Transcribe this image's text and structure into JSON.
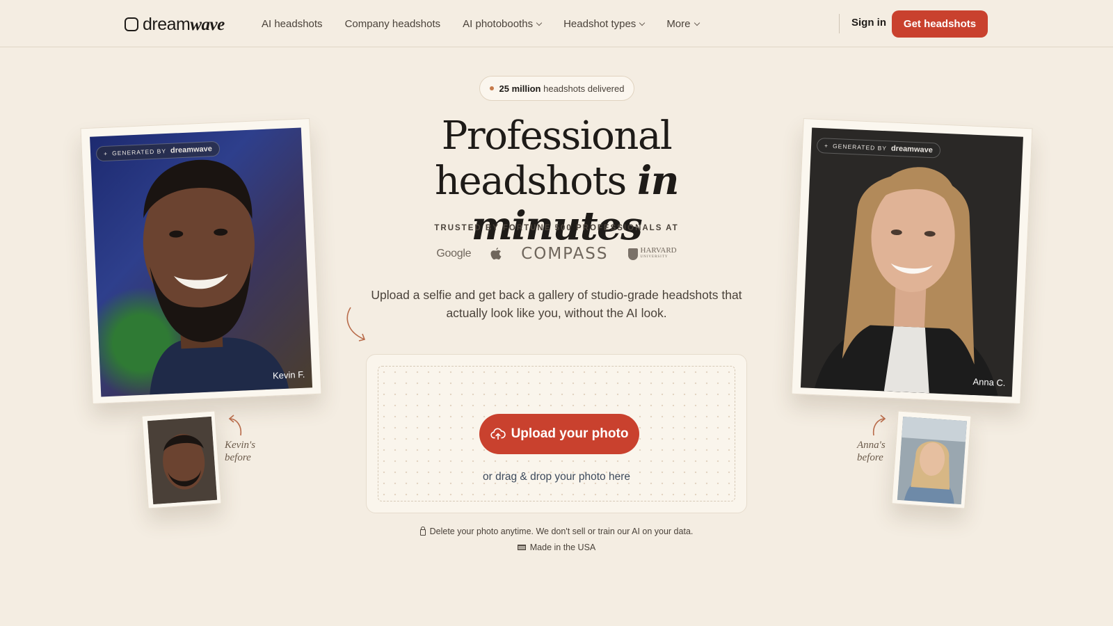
{
  "nav": {
    "logo_prefix": "dream",
    "logo_suffix": "wave",
    "links": [
      {
        "label": "AI headshots",
        "dropdown": false
      },
      {
        "label": "Company headshots",
        "dropdown": false
      },
      {
        "label": "AI photobooths",
        "dropdown": true
      },
      {
        "label": "Headshot types",
        "dropdown": true
      },
      {
        "label": "More",
        "dropdown": true
      }
    ],
    "signin": "Sign in",
    "cta": "Get headshots"
  },
  "hero": {
    "badge_bold": "25 million",
    "badge_rest": "headshots delivered",
    "headline_line1": "Professional",
    "headline_line2_plain": "headshots ",
    "headline_line2_em": "in minutes",
    "trusted": "TRUSTED BY FORTUNE 500 PROFESSIONALS AT",
    "logos": {
      "google": "Google",
      "compass": "COMPASS",
      "harvard_top": "HARVARD",
      "harvard_bottom": "UNIVERSITY"
    },
    "subtext": "Upload a selfie and get back a gallery of studio-grade headshots that actually look like you, without the AI look."
  },
  "upload": {
    "button": "Upload your photo",
    "drag": "or drag & drop your photo here"
  },
  "footer_notes": {
    "privacy": "Delete your photo anytime. We don't sell or train our AI on your data.",
    "usa": "Made in the USA"
  },
  "photos": {
    "generated_by": "GENERATED BY",
    "brand": "dreamwave",
    "kevin_name": "Kevin F.",
    "anna_name": "Anna C.",
    "kevin_before_1": "Kevin's",
    "kevin_before_2": "before",
    "anna_before_1": "Anna's",
    "anna_before_2": "before"
  },
  "colors": {
    "background": "#f4ede2",
    "accent": "#c9412e",
    "text": "#1e1b18"
  }
}
